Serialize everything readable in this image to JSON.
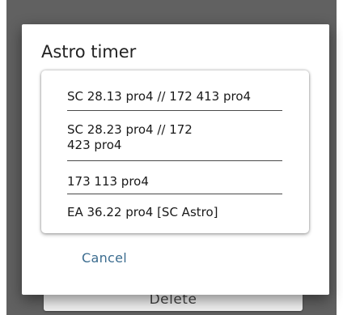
{
  "background": {
    "delete_label": "Delete"
  },
  "dialog": {
    "title": "Astro timer",
    "items": [
      {
        "label": "SC 28.13 pro4 // 172 413 pro4"
      },
      {
        "label": "SC 28.23 pro4 // 172\n423 pro4"
      },
      {
        "label": "173 113 pro4"
      },
      {
        "label": "EA 36.22 pro4 [SC Astro]"
      }
    ],
    "cancel_label": "Cancel"
  },
  "colors": {
    "overlay": "#616161",
    "accent": "#3b6c8f"
  }
}
